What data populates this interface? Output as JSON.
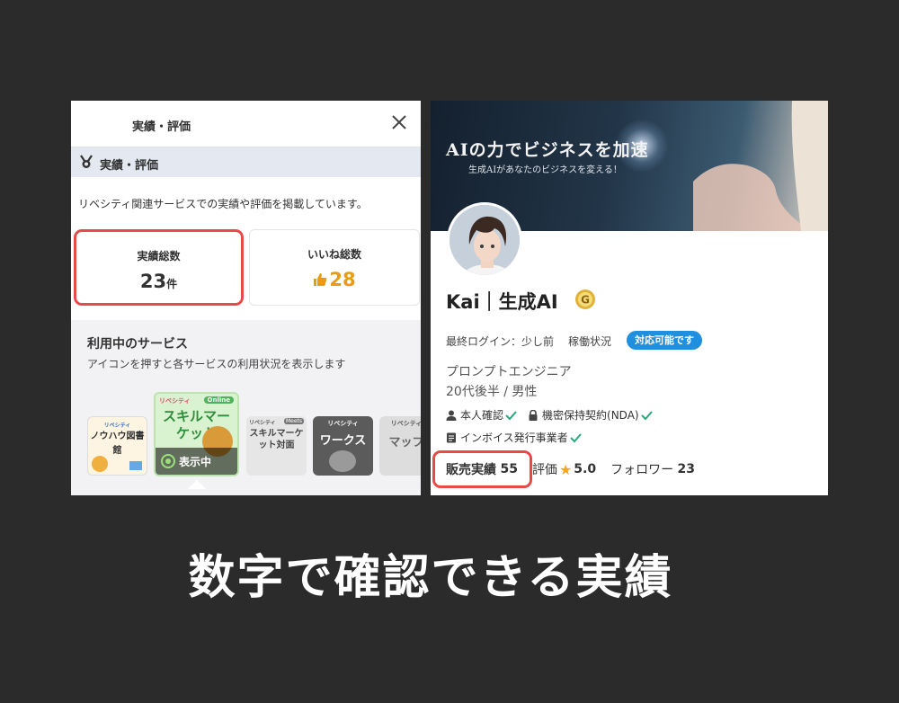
{
  "left_panel": {
    "header_title": "実績・評価",
    "section_label": "実績・評価",
    "description": "リベシティ関連サービスでの実績や評価を掲載しています。",
    "cards": [
      {
        "label": "実績総数",
        "value": "23",
        "unit": "件"
      },
      {
        "label": "いいね総数",
        "value": "28"
      }
    ],
    "services": {
      "heading": "利用中のサービス",
      "description": "アイコンを押すと各サービスの利用状況を表示します",
      "items": [
        {
          "brand": "リベシティ",
          "name": "ノウハウ図書館"
        },
        {
          "brand": "リベシティ",
          "tag": "Online",
          "name": "スキルマーケット",
          "overlay": "表示中"
        },
        {
          "brand": "リベシティ",
          "tag": "Meets",
          "name": "スキルマーケット対面"
        },
        {
          "brand": "リベシティ",
          "name": "ワークス"
        },
        {
          "brand": "リベシティ",
          "name": "マップ"
        }
      ]
    }
  },
  "right_panel": {
    "banner": {
      "title": "AIの力でビジネスを加速",
      "subtitle": "生成AIがあなたのビジネスを変える！"
    },
    "name": "Kai｜生成AI",
    "badge_letter": "G",
    "last_login": "最終ログイン：少し前",
    "work_status_label": "稼働状況",
    "work_status": "対応可能です",
    "job": "プロンプトエンジニア",
    "profile": "20代後半 / 男性",
    "verifications": [
      {
        "icon": "person-icon",
        "label": "本人確認"
      },
      {
        "icon": "lock-icon",
        "label": "機密保持契約(NDA)"
      },
      {
        "icon": "document-icon",
        "label": "インボイス発行事業者"
      }
    ],
    "stats": {
      "sales_label": "販売実績",
      "sales": "55",
      "rating_label": "評価",
      "rating": "5.0",
      "followers_label": "フォロワー",
      "followers": "23"
    }
  },
  "caption": "数字で確認できる実績",
  "colors": {
    "highlight": "#e84a4a",
    "accent_blue": "#1f8fe0",
    "like_orange": "#e99b15",
    "check_green": "#2aa77a",
    "star": "#f5a623"
  }
}
